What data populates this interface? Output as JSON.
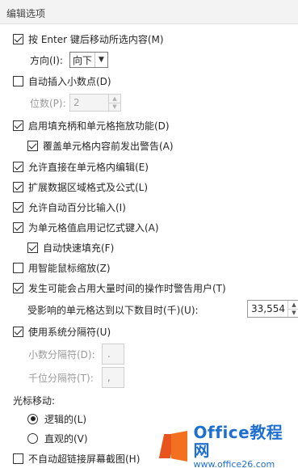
{
  "section": {
    "title": "编辑选项"
  },
  "options": {
    "move_after_enter": {
      "label": "按 Enter 键后移动所选内容(M)",
      "checked": true
    },
    "direction": {
      "label": "方向(I):",
      "value": "向下"
    },
    "auto_decimal": {
      "label": "自动插入小数点(D)",
      "checked": false
    },
    "places": {
      "label": "位数(P):",
      "value": "2"
    },
    "fill_handle": {
      "label": "启用填充柄和单元格拖放功能(D)",
      "checked": true
    },
    "alert_overwrite": {
      "label": "覆盖单元格内容前发出警告(A)",
      "checked": true
    },
    "edit_in_cell": {
      "label": "允许直接在单元格内编辑(E)",
      "checked": true
    },
    "extend_formats": {
      "label": "扩展数据区域格式及公式(L)",
      "checked": true
    },
    "auto_percent": {
      "label": "允许自动百分比输入(I)",
      "checked": true
    },
    "autocomplete": {
      "label": "为单元格值启用记忆式键入(A)",
      "checked": true
    },
    "flash_fill": {
      "label": "自动快速填充(F)",
      "checked": true
    },
    "zoom_intellimouse": {
      "label": "用智能鼠标缩放(Z)",
      "checked": false
    },
    "alert_slow": {
      "label": "发生可能会占用大量时间的操作时警告用户(T)",
      "checked": true
    },
    "cells_threshold": {
      "label": "受影响的单元格达到以下数目时(千)(U):",
      "value": "33,554"
    },
    "system_separators": {
      "label": "使用系统分隔符(U)",
      "checked": true
    },
    "decimal_sep": {
      "label": "小数分隔符(D):",
      "value": "."
    },
    "thousands_sep": {
      "label": "千位分隔符(T):",
      "value": ","
    }
  },
  "cursor": {
    "label": "光标移动:",
    "logical": {
      "label": "逻辑的(L)",
      "selected": true
    },
    "visual": {
      "label": "直观的(V)",
      "selected": false
    }
  },
  "no_hyperlink_screenshot": {
    "label": "不自动超链接屏幕截图(H)",
    "checked": false
  },
  "watermark": {
    "brand": "Office教程网",
    "url": "www.office26.com"
  }
}
